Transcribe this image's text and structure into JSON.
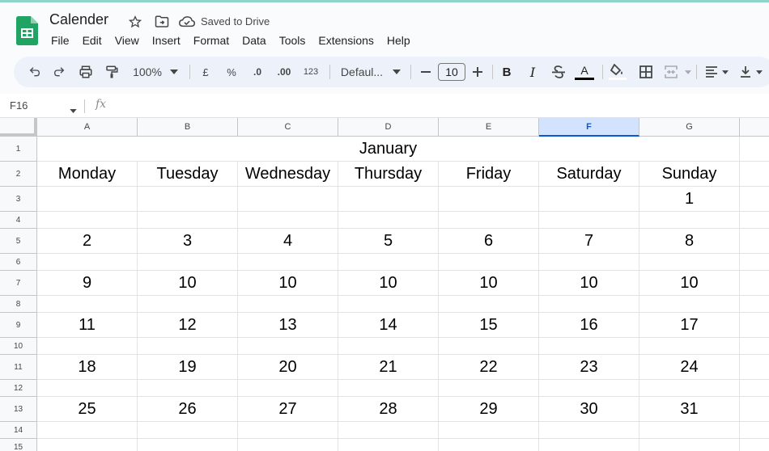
{
  "app": {
    "doc_title": "Calender",
    "saved_status": "Saved to Drive",
    "icons": {
      "logo": "google-sheets-logo-icon",
      "star": "star-icon",
      "move": "move-to-folder-icon",
      "cloud": "cloud-saved-icon"
    },
    "colors": {
      "brand_green": "#1fa463",
      "selected_col_bg": "#d3e3fd",
      "selected_col_text": "#0b57d0"
    }
  },
  "menu": [
    "File",
    "Edit",
    "View",
    "Insert",
    "Format",
    "Data",
    "Tools",
    "Extensions",
    "Help"
  ],
  "toolbar": {
    "zoom": "100%",
    "currency": "£",
    "percent": "%",
    "decrease_decimal": ".0",
    "increase_decimal": ".00",
    "number_format": "123",
    "font_family": "Defaul...",
    "font_size": "10",
    "bold": "B",
    "italic": "I",
    "text_color_letter": "A"
  },
  "formula_bar": {
    "cell_ref": "F16",
    "fx_label": "fx",
    "value": ""
  },
  "sheet": {
    "selected_column": "F",
    "columns": [
      "A",
      "B",
      "C",
      "D",
      "E",
      "F",
      "G"
    ],
    "rows": [
      "1",
      "2",
      "3",
      "4",
      "5",
      "6",
      "7",
      "8",
      "9",
      "10",
      "11",
      "12",
      "13",
      "14",
      "15"
    ],
    "title": "January",
    "weekdays": [
      "Monday",
      "Tuesday",
      "Wednesday",
      "Thursday",
      "Friday",
      "Saturday",
      "Sunday"
    ],
    "weeks": [
      [
        "",
        "",
        "",
        "",
        "",
        "",
        "1"
      ],
      [
        "2",
        "3",
        "4",
        "5",
        "6",
        "7",
        "8"
      ],
      [
        "9",
        "10",
        "10",
        "10",
        "10",
        "10",
        "10"
      ],
      [
        "11",
        "12",
        "13",
        "14",
        "15",
        "16",
        "17"
      ],
      [
        "18",
        "19",
        "20",
        "21",
        "22",
        "23",
        "24"
      ],
      [
        "25",
        "26",
        "27",
        "28",
        "29",
        "30",
        "31"
      ]
    ]
  }
}
